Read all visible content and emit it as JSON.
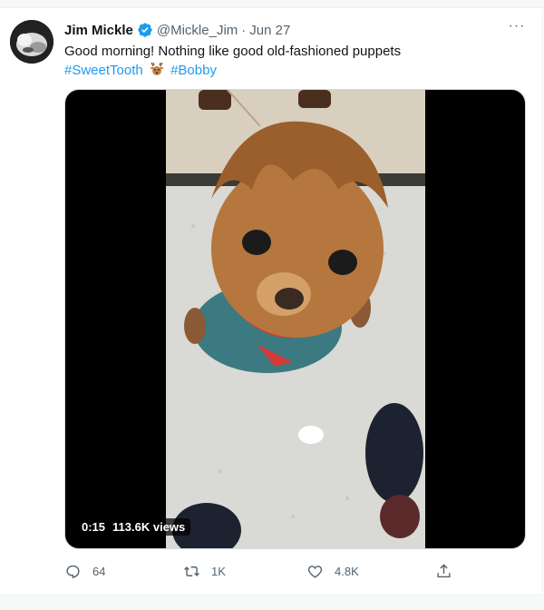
{
  "tweet": {
    "author_name": "Jim Mickle",
    "handle": "@Mickle_Jim",
    "separator": "·",
    "date": "Jun 27",
    "text": "Good morning! Nothing like good old-fashioned puppets",
    "hashtags": [
      "#SweetTooth",
      "#Bobby"
    ],
    "more_menu": "···"
  },
  "video": {
    "duration": "0:15",
    "views": "113.6K views"
  },
  "actions": {
    "replies": "64",
    "retweets": "1K",
    "likes": "4.8K"
  },
  "colors": {
    "link": "#1d9bf0",
    "secondary_text": "#536471",
    "verified": "#1d9bf0"
  }
}
